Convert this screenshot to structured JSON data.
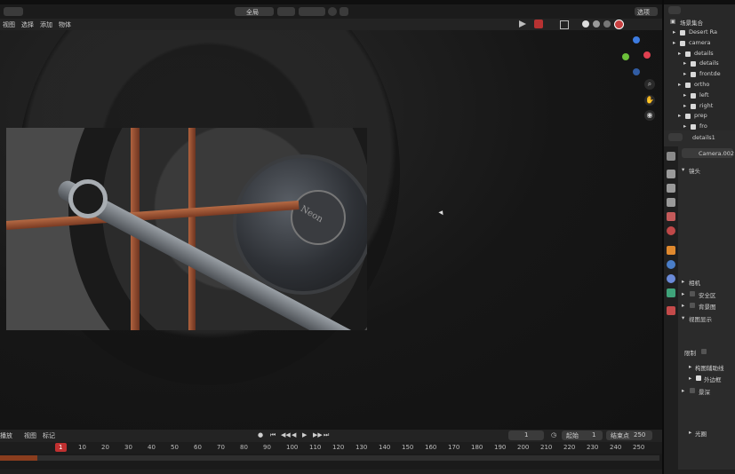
{
  "menus": [
    "视图",
    "选择",
    "添加",
    "物体"
  ],
  "toolbar": {
    "view_mode": "全局",
    "options_label": "选项"
  },
  "outliner": {
    "root": "场景集合",
    "items": [
      {
        "label": "Desert Ra"
      },
      {
        "label": "camera"
      },
      {
        "label": "details"
      },
      {
        "label": "details"
      },
      {
        "label": "frontde"
      },
      {
        "label": "ortho"
      },
      {
        "label": "left"
      },
      {
        "label": "right"
      },
      {
        "label": "prep"
      },
      {
        "label": "fro"
      }
    ]
  },
  "properties": {
    "object_name": "details1",
    "camera_name": "Camera.002",
    "sections": {
      "lens": "镜头",
      "camera": "相机",
      "safe_area": "安全区",
      "background": "背景图",
      "viewport_display": "视图显示",
      "limits": "限制",
      "composition": "构图辅助线",
      "passepartout": "外边框",
      "dof": "景深",
      "aperture": "光圈"
    }
  },
  "timeline": {
    "menus": [
      "播放",
      "视图",
      "标记"
    ],
    "current_frame": "1",
    "start_label": "起始",
    "start": "1",
    "end_label": "结束点",
    "end": "250",
    "ruler": [
      "1",
      "10",
      "20",
      "30",
      "40",
      "50",
      "60",
      "70",
      "80",
      "90",
      "100",
      "110",
      "120",
      "130",
      "140",
      "150",
      "160",
      "170",
      "180",
      "190",
      "200",
      "210",
      "220",
      "230",
      "240",
      "250"
    ]
  },
  "render": {
    "badge": "Neon"
  }
}
